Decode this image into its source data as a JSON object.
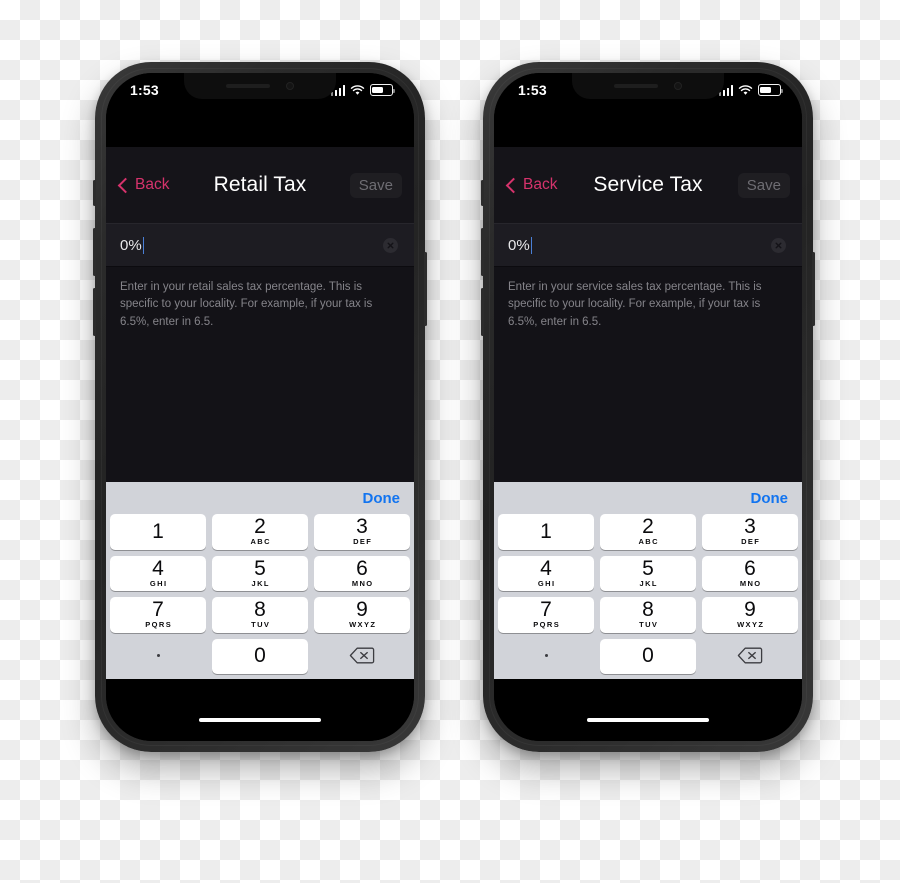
{
  "phones": [
    {
      "id": "retail",
      "status_bar": {
        "time": "1:53",
        "signal_icon": "cellular-signal-icon",
        "wifi_icon": "wifi-icon",
        "battery_icon": "battery-icon"
      },
      "nav": {
        "back_label": "Back",
        "back_icon": "chevron-left-icon",
        "title": "Retail Tax",
        "save_label": "Save",
        "save_enabled": false
      },
      "field": {
        "value": "0%",
        "clear_icon": "clear-circle-icon"
      },
      "description": "Enter in your retail sales tax percentage. This is specific to your locality. For example, if your tax is 6.5%, enter in 6.5.",
      "keypad": {
        "done_label": "Done",
        "keys": [
          {
            "num": "1",
            "letters": ""
          },
          {
            "num": "2",
            "letters": "ABC"
          },
          {
            "num": "3",
            "letters": "DEF"
          },
          {
            "num": "4",
            "letters": "GHI"
          },
          {
            "num": "5",
            "letters": "JKL"
          },
          {
            "num": "6",
            "letters": "MNO"
          },
          {
            "num": "7",
            "letters": "PQRS"
          },
          {
            "num": "8",
            "letters": "TUV"
          },
          {
            "num": "9",
            "letters": "WXYZ"
          },
          {
            "num": ".",
            "letters": "",
            "type": "decimal"
          },
          {
            "num": "0",
            "letters": ""
          },
          {
            "num": "",
            "letters": "",
            "type": "delete",
            "icon": "backspace-icon"
          }
        ]
      }
    },
    {
      "id": "service",
      "status_bar": {
        "time": "1:53",
        "signal_icon": "cellular-signal-icon",
        "wifi_icon": "wifi-icon",
        "battery_icon": "battery-icon"
      },
      "nav": {
        "back_label": "Back",
        "back_icon": "chevron-left-icon",
        "title": "Service Tax",
        "save_label": "Save",
        "save_enabled": false
      },
      "field": {
        "value": "0%",
        "clear_icon": "clear-circle-icon"
      },
      "description": "Enter in your service sales tax percentage. This is specific to your locality. For example, if your tax is 6.5%, enter in 6.5.",
      "keypad": {
        "done_label": "Done",
        "keys": [
          {
            "num": "1",
            "letters": ""
          },
          {
            "num": "2",
            "letters": "ABC"
          },
          {
            "num": "3",
            "letters": "DEF"
          },
          {
            "num": "4",
            "letters": "GHI"
          },
          {
            "num": "5",
            "letters": "JKL"
          },
          {
            "num": "6",
            "letters": "MNO"
          },
          {
            "num": "7",
            "letters": "PQRS"
          },
          {
            "num": "8",
            "letters": "TUV"
          },
          {
            "num": "9",
            "letters": "WXYZ"
          },
          {
            "num": ".",
            "letters": "",
            "type": "decimal"
          },
          {
            "num": "0",
            "letters": ""
          },
          {
            "num": "",
            "letters": "",
            "type": "delete",
            "icon": "backspace-icon"
          }
        ]
      }
    }
  ],
  "colors": {
    "accent_back": "#d6336c",
    "keyboard_done": "#1274f0",
    "keyboard_bg": "#d1d3d9",
    "nav_bg": "#151419",
    "field_bg": "#1d1c22",
    "body_bg": "#131217",
    "key_face": "#ffffff"
  }
}
